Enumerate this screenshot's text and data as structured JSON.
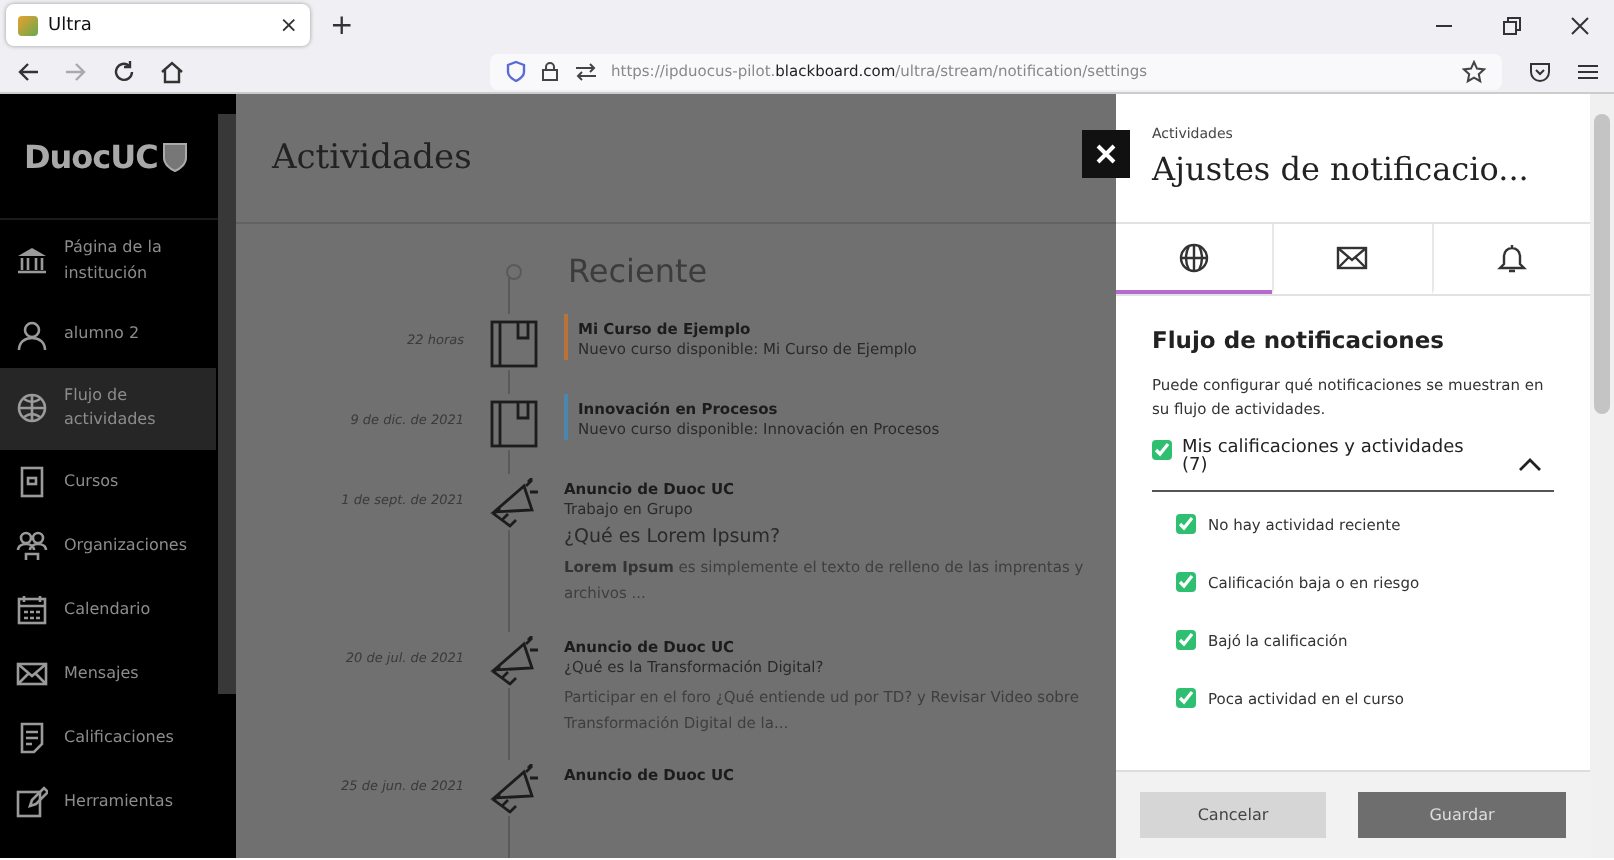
{
  "browser": {
    "tab_title": "Ultra",
    "tab_close": "×",
    "new_tab": "+",
    "url": "https://ipduocus-pilot.**blackboard.com**/ultra/stream/notification/settings"
  },
  "sidebar": {
    "logo": "DuocUC",
    "items": [
      {
        "label": "Página de la institución",
        "selected": false
      },
      {
        "label": "alumno 2",
        "selected": false
      },
      {
        "label": "Flujo de actividades",
        "selected": true
      },
      {
        "label": "Cursos",
        "selected": false
      },
      {
        "label": "Organizaciones",
        "selected": false
      },
      {
        "label": "Calendario",
        "selected": false
      },
      {
        "label": "Mensajes",
        "selected": false
      },
      {
        "label": "Calificaciones",
        "selected": false
      },
      {
        "label": "Herramientas",
        "selected": false
      }
    ]
  },
  "main": {
    "title": "Actividades",
    "section": "Reciente",
    "items": [
      {
        "kind": "course",
        "date": "22 horas",
        "title": "Mi Curso de Ejemplo",
        "subtitle": "Nuevo curso disponible: Mi Curso de Ejemplo",
        "color": "#b8733a"
      },
      {
        "kind": "course",
        "date": "9 de dic. de 2021",
        "title": "Innovación en Procesos",
        "subtitle": "Nuevo curso disponible: Innovación en Procesos",
        "color": "#4a86ad"
      },
      {
        "kind": "announcement",
        "date": "1 de sept. de 2021",
        "title": "Anuncio de Duoc UC",
        "subtitle": "Trabajo en Grupo",
        "heading": "¿Qué es Lorem Ipsum?",
        "body": "**Lorem Ipsum** es simplemente el texto de relleno de las imprentas y archivos ..."
      },
      {
        "kind": "announcement",
        "date": "20 de jul. de 2021",
        "title": "Anuncio de Duoc UC",
        "subtitle": "¿Qué es la Transformación Digital?",
        "body": "Participar en el foro ¿Qué entiende ud por TD? y Revisar Video sobre Transformación Digital de la..."
      },
      {
        "kind": "announcement",
        "date": "25 de jun. de 2021",
        "title": "Anuncio de Duoc UC"
      }
    ]
  },
  "panel": {
    "breadcrumb": "Actividades",
    "title": "Ajustes de notificacio...",
    "tabs": [
      {
        "selected": true
      },
      {
        "selected": false
      },
      {
        "selected": false
      }
    ],
    "section_title": "Flujo de notificaciones",
    "description": "Puede configurar qué notificaciones se muestran en su flujo de actividades.",
    "group": {
      "label": "Mis calificaciones y actividades (7)",
      "checked": true,
      "expanded": true
    },
    "options": [
      {
        "label": "No hay actividad reciente",
        "checked": true
      },
      {
        "label": "Calificación baja o en riesgo",
        "checked": true
      },
      {
        "label": "Bajó la calificación",
        "checked": true
      },
      {
        "label": "Poca actividad en el curso",
        "checked": true
      }
    ],
    "cancel": "Cancelar",
    "save": "Guardar"
  }
}
